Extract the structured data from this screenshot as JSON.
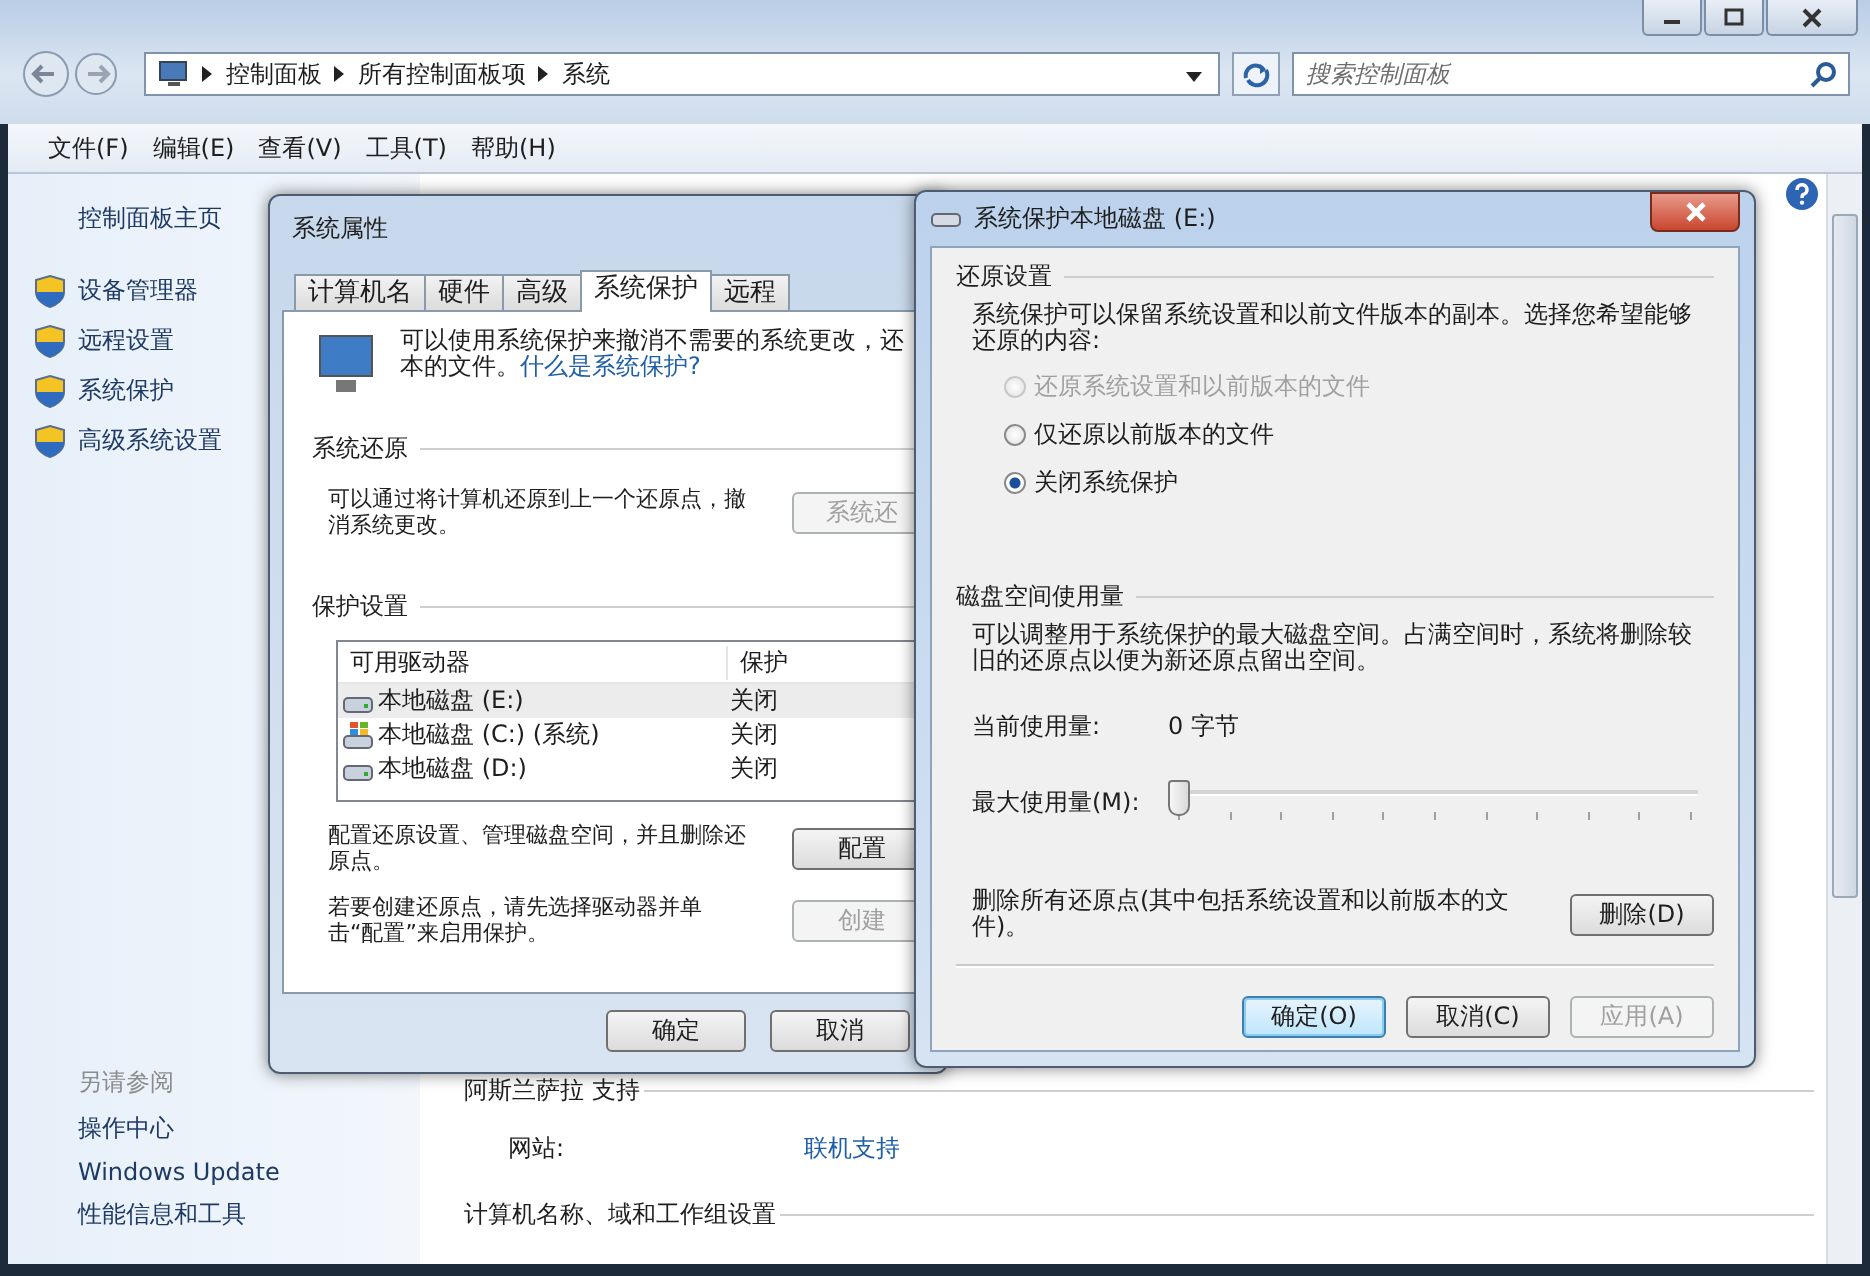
{
  "explorer": {
    "breadcrumb": [
      "控制面板",
      "所有控制面板项",
      "系统"
    ],
    "search": {
      "placeholder": "搜索控制面板"
    },
    "menu": [
      "文件(F)",
      "编辑(E)",
      "查看(V)",
      "工具(T)",
      "帮助(H)"
    ],
    "sidebar": {
      "home": "控制面板主页",
      "links": [
        "设备管理器",
        "远程设置",
        "系统保护",
        "高级系统设置"
      ],
      "see_also": "另请参阅",
      "see_also_links": [
        "操作中心",
        "Windows Update",
        "性能信息和工具"
      ]
    },
    "content": {
      "support_heading": "阿斯兰萨拉 支持",
      "website_label": "网站:",
      "website_link": "联机支持",
      "computer_heading": "计算机名称、域和工作组设置"
    }
  },
  "system_properties": {
    "title": "系统属性",
    "tabs": [
      {
        "label": "计算机名",
        "selected": false
      },
      {
        "label": "硬件",
        "selected": false
      },
      {
        "label": "高级",
        "selected": false
      },
      {
        "label": "系统保护",
        "selected": true
      },
      {
        "label": "远程",
        "selected": false
      }
    ],
    "intro": "可以使用系统保护来撤消不需要的系统更改，还",
    "intro_line2": "本的文件。",
    "help_link": "什么是系统保护?",
    "restore_heading": "系统还原",
    "restore_text": "可以通过将计算机还原到上一个还原点，撤消系统更改。",
    "restore_button": {
      "label": "系统还",
      "disabled": true
    },
    "protection_heading": "保护设置",
    "columns": [
      "可用驱动器",
      "保护"
    ],
    "drives": [
      {
        "name": "本地磁盘 (E:)",
        "protection": "关闭",
        "kind": "disk",
        "selected": true
      },
      {
        "name": "本地磁盘 (C:) (系统)",
        "protection": "关闭",
        "kind": "system",
        "selected": false
      },
      {
        "name": "本地磁盘 (D:)",
        "protection": "关闭",
        "kind": "disk",
        "selected": false
      }
    ],
    "configure_text": "配置还原设置、管理磁盘空间，并且删除还原点。",
    "configure_button": {
      "label": "配置",
      "disabled": false
    },
    "create_text": "若要创建还原点，请先选择驱动器并单击“配置”来启用保护。",
    "create_button": {
      "label": "创建",
      "disabled": true
    },
    "buttons": [
      "确定",
      "取消"
    ]
  },
  "dialog": {
    "title": "系统保护本地磁盘 (E:)",
    "restore_heading": "还原设置",
    "restore_text": "系统保护可以保留系统设置和以前文件版本的副本。选择您希望能够还原的内容:",
    "options": [
      {
        "label": "还原系统设置和以前版本的文件",
        "selected": false,
        "disabled": true
      },
      {
        "label": "仅还原以前版本的文件",
        "selected": false,
        "disabled": false
      },
      {
        "label": "关闭系统保护",
        "selected": true,
        "disabled": false
      }
    ],
    "disk_heading": "磁盘空间使用量",
    "disk_text": "可以调整用于系统保护的最大磁盘空间。占满空间时，系统将删除较旧的还原点以便为新还原点留出空间。",
    "current_label": "当前使用量:",
    "current_value": "0 字节",
    "max_label": "最大使用量(M):",
    "slider": {
      "level": 0
    },
    "delete_text": "删除所有还原点(其中包括系统设置和以前版本的文件)。",
    "delete_button": "删除(D)",
    "buttons": [
      {
        "label": "确定(O)",
        "default": true,
        "disabled": false
      },
      {
        "label": "取消(C)",
        "default": false,
        "disabled": false
      },
      {
        "label": "应用(A)",
        "default": false,
        "disabled": true
      }
    ]
  }
}
